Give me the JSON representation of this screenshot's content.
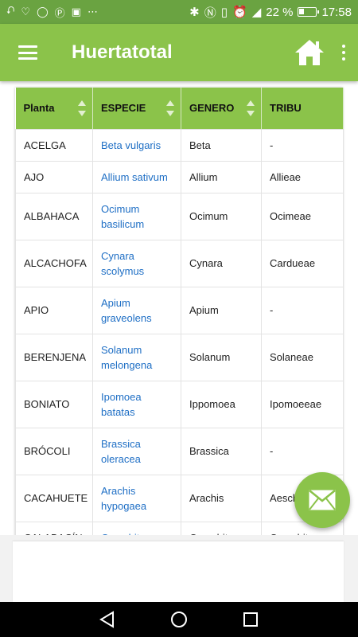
{
  "status_bar": {
    "left_icons": [
      "usb-icon",
      "heart-icon",
      "whatsapp-icon",
      "pinterest-icon",
      "car-icon",
      "more-dots-icon"
    ],
    "battery_percent": "22 %",
    "time": "17:58"
  },
  "app_bar": {
    "title": "Huertatotal"
  },
  "table": {
    "headers": [
      "Planta",
      "ESPECIE",
      "GENERO",
      "TRIBU"
    ],
    "rows": [
      {
        "planta": "ACELGA",
        "especie": "Beta vulgaris",
        "genero": "Beta",
        "tribu": "-"
      },
      {
        "planta": "AJO",
        "especie": "Allium sativum",
        "genero": "Allium",
        "tribu": "Allieae"
      },
      {
        "planta": "ALBAHACA",
        "especie": "Ocimum basilicum",
        "genero": "Ocimum",
        "tribu": "Ocimeae"
      },
      {
        "planta": "ALCACHOFA",
        "especie": "Cynara scolymus",
        "genero": "Cynara",
        "tribu": "Cardueae"
      },
      {
        "planta": "APIO",
        "especie": "Apium graveolens",
        "genero": "Apium",
        "tribu": "-"
      },
      {
        "planta": "BERENJENA",
        "especie": "Solanum melongena",
        "genero": "Solanum",
        "tribu": "Solaneae"
      },
      {
        "planta": "BONIATO",
        "especie": "Ipomoea batatas",
        "genero": "Ippomoea",
        "tribu": "Ipomoeeae"
      },
      {
        "planta": "BRÓCOLI",
        "especie": "Brassica oleracea",
        "genero": "Brassica",
        "tribu": "-"
      },
      {
        "planta": "CACAHUETE",
        "especie": "Arachis hypogaea",
        "genero": "Arachis",
        "tribu": "Aeschynomeneae"
      },
      {
        "planta": "CALABACÍN",
        "especie": "Cucurbita pepo",
        "genero": "Cucurbita",
        "tribu": "Cucurbiteae"
      }
    ]
  },
  "colors": {
    "status_bar": "#6aa341",
    "app_bar": "#8bc34a",
    "link": "#1f6fc5"
  }
}
